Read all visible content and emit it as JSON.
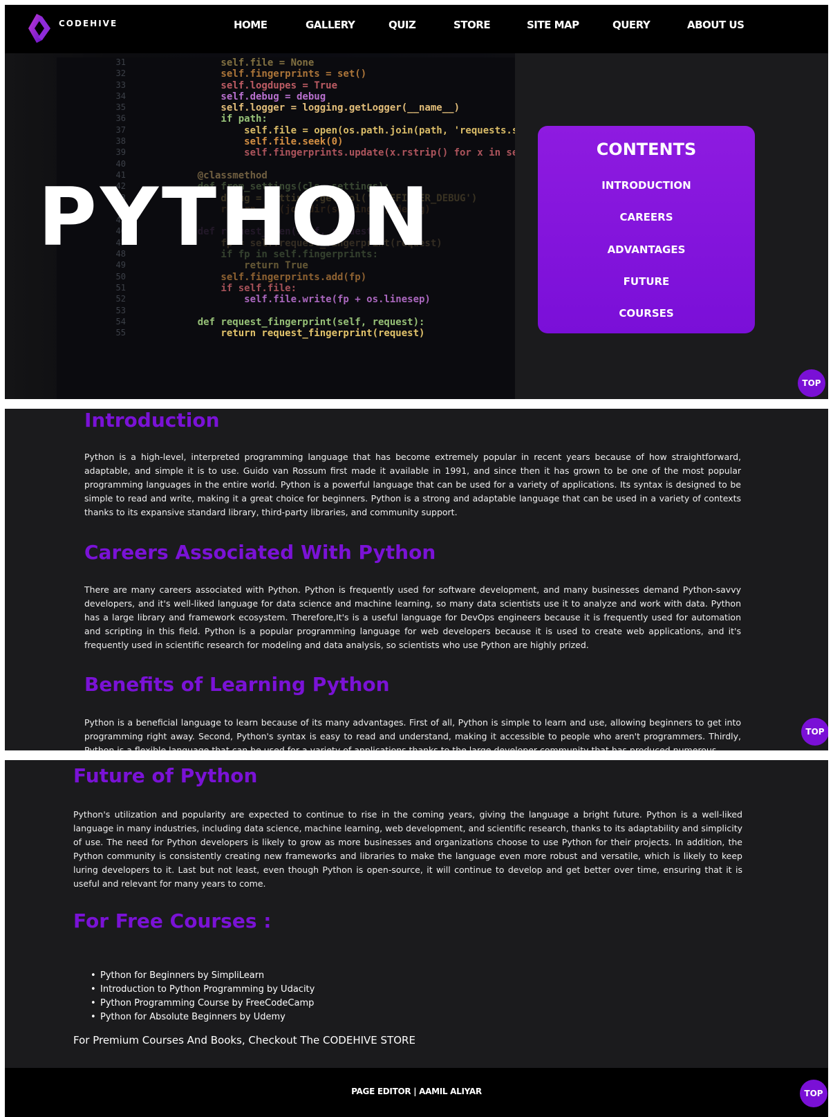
{
  "header": {
    "brand": "CODEHIVE",
    "nav": [
      "HOME",
      "GALLERY",
      "QUIZ",
      "STORE",
      "SITE MAP",
      "QUERY",
      "ABOUT US"
    ]
  },
  "hero": {
    "title": "PYTHON",
    "code_gutter": [
      "31",
      "32",
      "33",
      "34",
      "35",
      "36",
      "37",
      "38",
      "39",
      "40",
      "41",
      "42",
      "43",
      "44",
      "45",
      "46",
      "47",
      "48",
      "49",
      "50",
      "51",
      "52",
      "53",
      "54",
      "55"
    ],
    "code_lines": [
      "        self.file = None",
      "        self.fingerprints = set()",
      "        self.logdupes = True",
      "        self.debug = debug",
      "        self.logger = logging.getLogger(__name__)",
      "        if path:",
      "            self.file = open(os.path.join(path, 'requests.seen'))",
      "            self.file.seek(0)",
      "            self.fingerprints.update(x.rstrip() for x in self.file)",
      "",
      "    @classmethod",
      "    def from_settings(cls, settings):",
      "        debug = settings.getbool('DUPEFILTER_DEBUG')",
      "        return cls(job_dir(settings), debug)",
      "",
      "    def request_seen(self, request):",
      "        fp = self.request_fingerprint(request)",
      "        if fp in self.fingerprints:",
      "            return True",
      "        self.fingerprints.add(fp)",
      "        if self.file:",
      "            self.file.write(fp + os.linesep)",
      "",
      "    def request_fingerprint(self, request):",
      "        return request_fingerprint(request)"
    ]
  },
  "toc": {
    "title": "CONTENTS",
    "items": [
      "INTRODUCTION",
      "CAREERS",
      "ADVANTAGES",
      "FUTURE",
      "COURSES"
    ]
  },
  "top_button": "TOP",
  "sections": {
    "introduction": {
      "heading": "Introduction",
      "text": "Python is a high-level, interpreted programming language that has become extremely popular in recent years because of how straightforward, adaptable, and simple it is to use. Guido van Rossum first made it available in 1991, and since then it has grown to be one of the most popular programming languages in the entire world. Python is a powerful language that can be used for a variety of applications. Its syntax is designed to be simple to read and write, making it a great choice for beginners. Python is a strong and adaptable language that can be used in a variety of contexts thanks to its expansive standard library, third-party libraries, and community support."
    },
    "careers": {
      "heading": "Careers Associated With Python",
      "text": "There are many careers associated with Python. Python is frequently used for software development, and many businesses demand Python-savvy developers, and it's well-liked language for data science and machine learning, so many data scientists use it to analyze and work with data. Python has a large library and framework ecosystem. Therefore,It's is a useful language for DevOps engineers because it is frequently used for automation and scripting in this field. Python is a popular programming language for web developers because it is used to create web applications, and it's frequently used in scientific research for modeling and data analysis, so scientists who use Python are highly prized."
    },
    "benefits": {
      "heading": "Benefits of Learning Python",
      "text": "Python is a beneficial language to learn because of its many advantages. First of all, Python is simple to learn and use, allowing beginners to get into programming right away. Second, Python's syntax is easy to read and understand, making it accessible to people who aren't programmers. Thirdly, Python is a flexible language that can be used for a variety of applications thanks to the large developer community that has produced numerous"
    },
    "future": {
      "heading": "Future of Python",
      "text": "Python's utilization and popularity are expected to continue to rise in the coming years, giving the language a bright future. Python is a well-liked language in many industries, including data science, machine learning, web development, and scientific research, thanks to its adaptability and simplicity of use. The need for Python developers is likely to grow as more businesses and organizations choose to use Python for their projects. In addition, the Python community is consistently creating new frameworks and libraries to make the language even more robust and versatile, which is likely to keep luring developers to it. Last but not least, even though Python is open-source, it will continue to develop and get better over time, ensuring that it is useful and relevant for many years to come."
    },
    "courses": {
      "heading": "For Free Courses :",
      "items": [
        "Python for Beginners by SimpliLearn",
        "Introduction to Python Programming by Udacity",
        "Python Programming Course by FreeCodeCamp",
        "Python for Absolute Beginners by Udemy"
      ],
      "premium": "For Premium Courses And Books, Checkout The CODEHIVE STORE"
    }
  },
  "footer": {
    "text": "PAGE EDITOR | AAMIL ALIYAR"
  },
  "colors": {
    "accent": "#7a12d6",
    "background": "#1b1b1d",
    "navbar": "#000000"
  }
}
